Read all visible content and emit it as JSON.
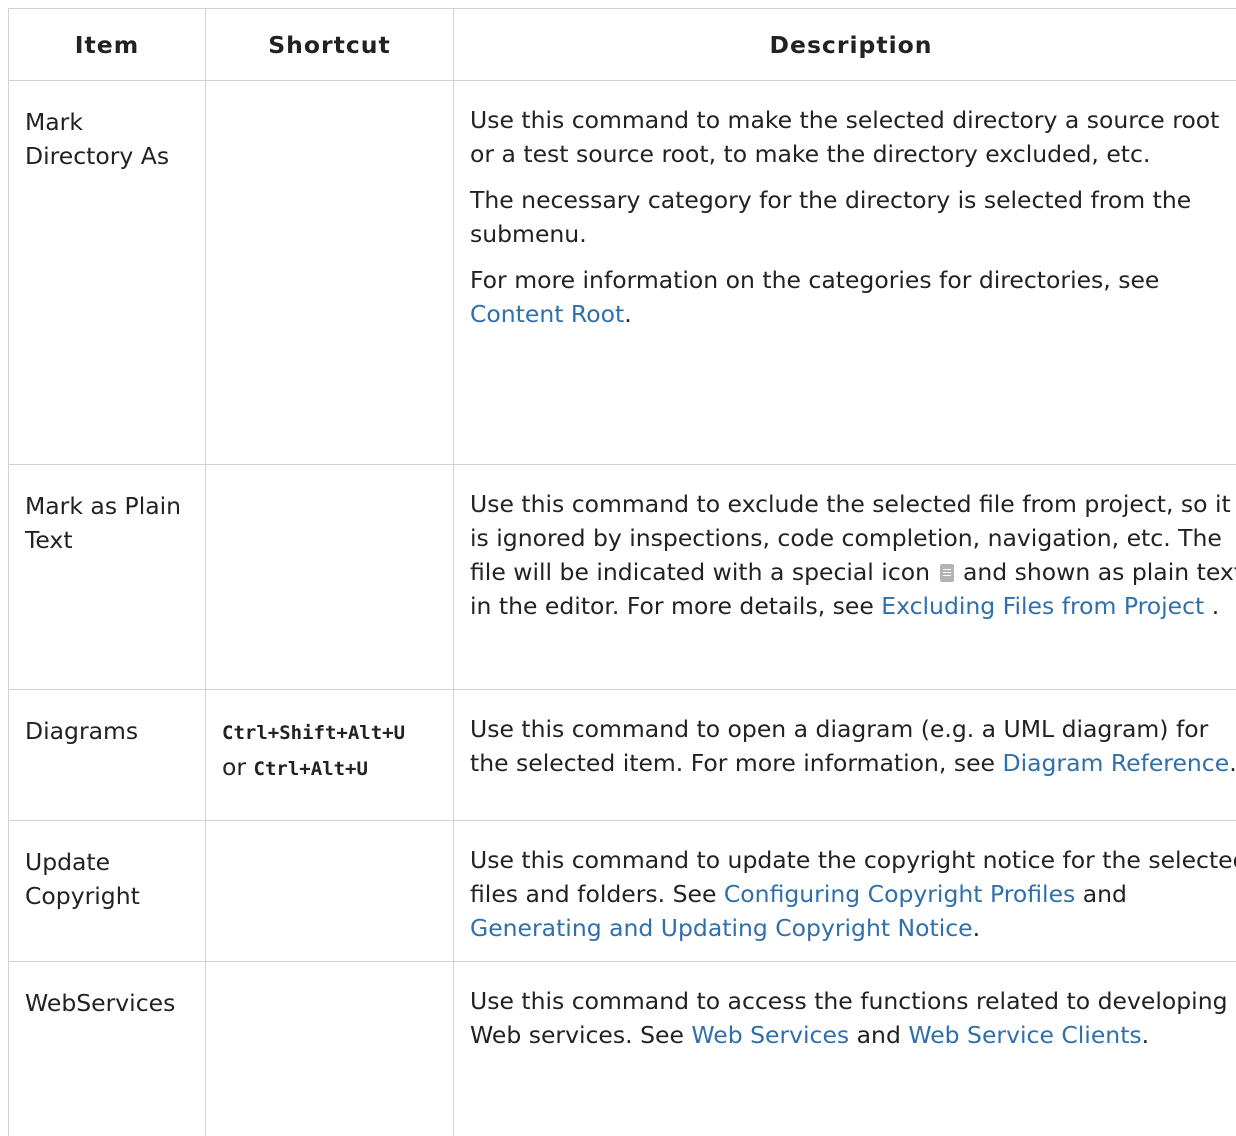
{
  "headers": {
    "item": "Item",
    "shortcut": "Shortcut",
    "description": "Description"
  },
  "rows": [
    {
      "item": "Mark Directory As",
      "desc_p1": "Use this command to make the selected directory a source root or a test source root, to make the directory excluded, etc.",
      "desc_p2": "The necessary category for the directory is selected from the submenu.",
      "desc_p3_pre": "For more information on the categories for directories, see ",
      "desc_p3_link": "Content Root",
      "desc_p3_post": "."
    },
    {
      "item": "Mark as Plain Text",
      "desc_pre": "Use this command to exclude the selected file from project, so it is ignored by inspections, code completion, navigation, etc. The file will be indicated with a special icon ",
      "desc_mid": " and shown as plain text in the editor. For more details, see ",
      "desc_link": "Excluding Files from Project",
      "desc_post": " ."
    },
    {
      "item": "Diagrams",
      "shortcut_1": "Ctrl+Shift+Alt+U",
      "shortcut_or": "or ",
      "shortcut_2": "Ctrl+Alt+U",
      "desc_pre": "Use this command to open a diagram (e.g. a UML diagram) for the selected item. For more information, see ",
      "desc_link": "Diagram Reference",
      "desc_post": "."
    },
    {
      "item": "Update Copyright",
      "desc_pre": "Use this command to update the copyright notice for the selected files and folders. See ",
      "desc_link1": "Configuring Copyright Profiles",
      "desc_mid": " and ",
      "desc_link2": "Generating and Updating Copyright Notice",
      "desc_post": "."
    },
    {
      "item": "WebServices",
      "desc_pre": "Use this command to access the functions related to developing Web services. See ",
      "desc_link1": "Web Services",
      "desc_mid": " and ",
      "desc_link2": "Web Service Clients",
      "desc_post": "."
    }
  ],
  "icons": {
    "plain_text_file": "plain-text-file-icon"
  },
  "colors": {
    "link": "#2f6fab",
    "border": "#d2d2d2",
    "text": "#222222"
  }
}
